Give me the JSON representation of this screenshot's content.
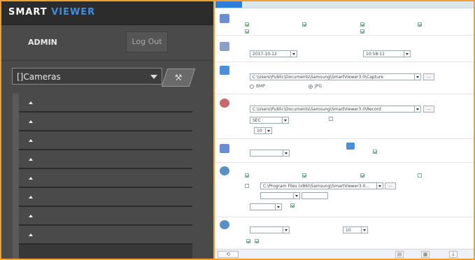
{
  "app": {
    "logo_main": "SMART",
    "logo_accent": "VIEWER"
  },
  "user": {
    "name": "ADMIN",
    "logout_label": "Log Out"
  },
  "cameras": {
    "selected": "[]Cameras",
    "tool_icon": "cameras-tool-icon"
  },
  "camera_list": {
    "item_count": 8
  },
  "settings": {
    "date_value": "2017-10-12",
    "time_value": "10:58:11",
    "capture_path": "C:\\Users\\Public\\Documents\\Samsung\\SmartViewer3.0\\Capture",
    "capture_format_bmp": "BMP",
    "capture_format_jpg": "JPG",
    "record_path": "C:\\Users\\Public\\Documents\\Samsung\\SmartViewer3.0\\Record",
    "record_unit": "SEC",
    "record_value": "10",
    "program_path": "C:\\Program Files (x86)\\Samsung\\SmartViewer3.0...",
    "bottom_value": "10",
    "browse_label": "..."
  },
  "footer": {
    "back_icon": "back-icon"
  },
  "colors": {
    "accent": "#3b8fe0",
    "border": "#f0a030",
    "tab": "#2c7ed6"
  }
}
